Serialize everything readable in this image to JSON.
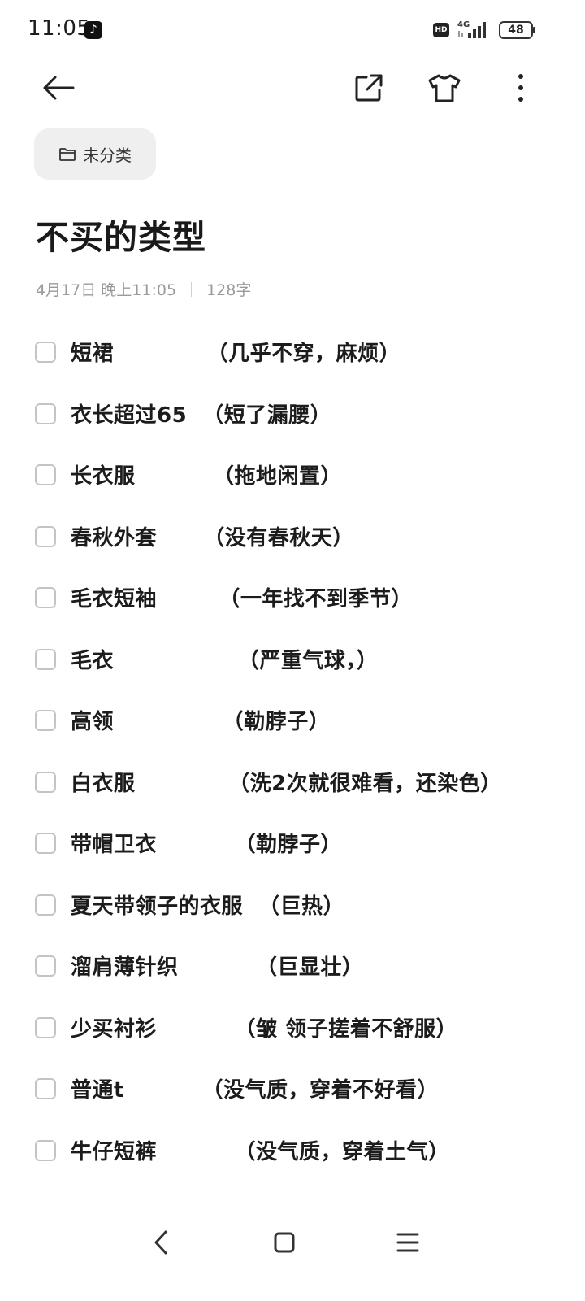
{
  "status_bar": {
    "time": "11:05",
    "app_icon": "tiktok-icon",
    "hd_label": "HD",
    "network": "4G",
    "battery": "48"
  },
  "toolbar": {
    "back_icon": "back-arrow-icon",
    "share_icon": "share-icon",
    "theme_icon": "shirt-icon",
    "more_icon": "more-vertical-icon"
  },
  "folder": {
    "label": "未分类",
    "icon": "folder-icon"
  },
  "note": {
    "title": "不买的类型",
    "date": "4月17日 晚上11:05",
    "word_count": "128字"
  },
  "checklist": [
    {
      "text": "短裙            （几乎不穿，麻烦）",
      "checked": false
    },
    {
      "text": "衣长超过65  （短了漏腰）",
      "checked": false
    },
    {
      "text": "长衣服          （拖地闲置）",
      "checked": false
    },
    {
      "text": "春秋外套      （没有春秋天）",
      "checked": false
    },
    {
      "text": "毛衣短袖        （一年找不到季节）",
      "checked": false
    },
    {
      "text": "毛衣                （严重气球，）",
      "checked": false
    },
    {
      "text": "高领              （勒脖子）",
      "checked": false
    },
    {
      "text": "白衣服            （洗2次就很难看，还染色）",
      "checked": false
    },
    {
      "text": "带帽卫衣          （勒脖子）",
      "checked": false
    },
    {
      "text": "夏天带领子的衣服  （巨热）",
      "checked": false
    },
    {
      "text": "溜肩薄针织          （巨显壮）",
      "checked": false
    },
    {
      "text": "少买衬衫          （皱 领子搓着不舒服）",
      "checked": false
    },
    {
      "text": "普通t          （没气质，穿着不好看）",
      "checked": false
    },
    {
      "text": "牛仔短裤          （没气质，穿着土气）",
      "checked": false
    }
  ],
  "nav_bar": {
    "back_icon": "nav-back-icon",
    "home_icon": "nav-home-icon",
    "recents_icon": "nav-menu-icon"
  }
}
